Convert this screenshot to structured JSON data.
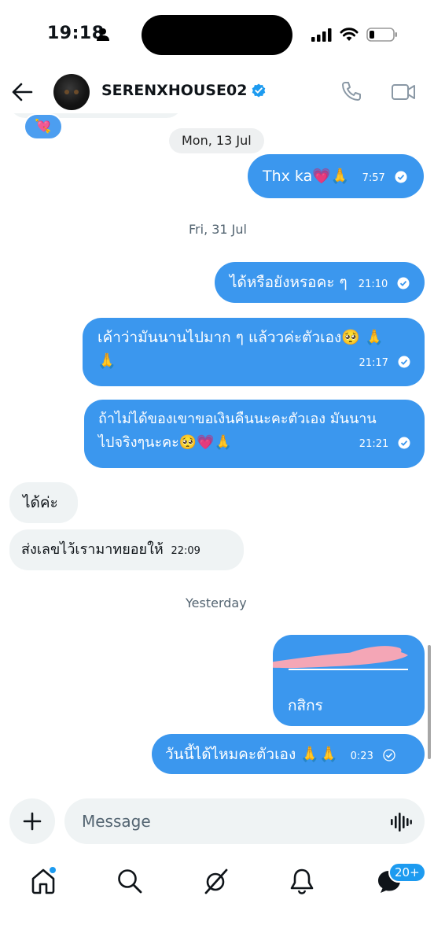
{
  "status_bar": {
    "time": "19:18"
  },
  "header": {
    "name": "SERENXHOUSE02"
  },
  "chat": {
    "dates": [
      "Mon, 13 Jul",
      "Fri, 31 Jul",
      "Yesterday"
    ],
    "messages": [
      {
        "text": "Thx ka💗🙏",
        "time": "7:57"
      },
      {
        "text": "ได้หรือยังหรอคะ ๆ",
        "time": "21:10"
      },
      {
        "line1": "เค้าว่ามันนานไปมาก ๆ แล้ววค่ะตัวเอง🥺 🙏",
        "line2": "🙏",
        "time": "21:17"
      },
      {
        "line1": "ถ้าไม่ได้ของเขาขอเงินคืนนะคะตัวเอง มันนาน",
        "line2": "ไปจริงๆนะคะ🥺💗🙏",
        "time": "21:21"
      },
      {
        "text": "ได้ค่ะ"
      },
      {
        "text": "ส่งเลขไว้เรามาทยอยให้",
        "time": "22:09"
      },
      {
        "text": "กสิกร"
      },
      {
        "text": "วันนี้ได้ไหมคะตัวเอง 🙏🙏",
        "time": "0:23"
      }
    ],
    "reaction": "💘"
  },
  "composer": {
    "placeholder": "Message"
  },
  "tabbar": {
    "messages_badge": "20+"
  },
  "colors": {
    "accent": "#1d9bf0",
    "bubble_out": "#3b97ee",
    "bubble_in": "#eff3f4"
  }
}
